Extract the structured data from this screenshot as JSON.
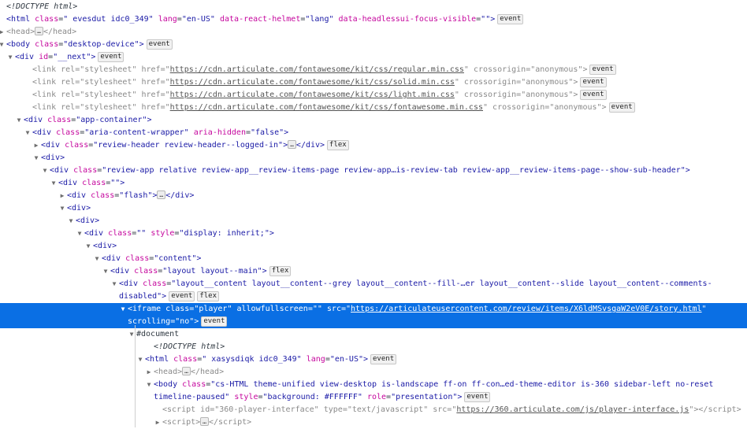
{
  "colors": {
    "selection": "#0a6fe4",
    "tag": "#1a1aa6",
    "attribute": "#c5069d"
  },
  "rows": [
    {
      "level": 0,
      "noarrowpad": true,
      "tokens": [
        {
          "k": "comment",
          "t": "<!DOCTYPE html>"
        }
      ]
    },
    {
      "level": 0,
      "noarrowpad": true,
      "tokens": [
        {
          "k": "tag",
          "t": "<html "
        },
        {
          "k": "attr",
          "t": "class"
        },
        {
          "k": "plain",
          "t": "="
        },
        {
          "k": "val",
          "t": "\" evesdut idc0_349\" "
        },
        {
          "k": "attr",
          "t": "lang"
        },
        {
          "k": "plain",
          "t": "="
        },
        {
          "k": "val",
          "t": "\"en-US\" "
        },
        {
          "k": "attr",
          "t": "data-react-helmet"
        },
        {
          "k": "plain",
          "t": "="
        },
        {
          "k": "val",
          "t": "\"lang\" "
        },
        {
          "k": "attr",
          "t": "data-headlessui-focus-visible"
        },
        {
          "k": "plain",
          "t": "="
        },
        {
          "k": "val",
          "t": "\"\">"
        },
        {
          "k": "badge",
          "t": "event"
        }
      ]
    },
    {
      "level": -1,
      "arrow": "collapsed",
      "dim": true,
      "tokens": [
        {
          "k": "tag",
          "t": "<head>"
        },
        {
          "k": "ell",
          "t": "…"
        },
        {
          "k": "tag",
          "t": "</head>"
        }
      ]
    },
    {
      "level": -1,
      "arrow": "expanded",
      "tokens": [
        {
          "k": "tag",
          "t": "<body "
        },
        {
          "k": "attr",
          "t": "class"
        },
        {
          "k": "plain",
          "t": "="
        },
        {
          "k": "val",
          "t": "\"desktop-device\">"
        },
        {
          "k": "badge",
          "t": "event"
        }
      ]
    },
    {
      "level": 0,
      "arrow": "expanded",
      "tokens": [
        {
          "k": "tag",
          "t": "<div "
        },
        {
          "k": "attr",
          "t": "id"
        },
        {
          "k": "plain",
          "t": "="
        },
        {
          "k": "val",
          "t": "\"__next\">"
        },
        {
          "k": "badge",
          "t": "event"
        }
      ]
    },
    {
      "level": 2,
      "dim": true,
      "tokens": [
        {
          "k": "tag",
          "t": "<link "
        },
        {
          "k": "attr",
          "t": "rel"
        },
        {
          "k": "plain",
          "t": "="
        },
        {
          "k": "val",
          "t": "\"stylesheet\" "
        },
        {
          "k": "attr",
          "t": "href"
        },
        {
          "k": "plain",
          "t": "=\""
        },
        {
          "k": "link",
          "t": "https://cdn.articulate.com/fontawesome/kit/css/regular.min.css"
        },
        {
          "k": "val",
          "t": "\" "
        },
        {
          "k": "attr",
          "t": "crossorigin"
        },
        {
          "k": "plain",
          "t": "="
        },
        {
          "k": "val",
          "t": "\"anonymous\">"
        },
        {
          "k": "badge",
          "t": "event"
        }
      ]
    },
    {
      "level": 2,
      "dim": true,
      "tokens": [
        {
          "k": "tag",
          "t": "<link "
        },
        {
          "k": "attr",
          "t": "rel"
        },
        {
          "k": "plain",
          "t": "="
        },
        {
          "k": "val",
          "t": "\"stylesheet\" "
        },
        {
          "k": "attr",
          "t": "href"
        },
        {
          "k": "plain",
          "t": "=\""
        },
        {
          "k": "link",
          "t": "https://cdn.articulate.com/fontawesome/kit/css/solid.min.css"
        },
        {
          "k": "val",
          "t": "\" "
        },
        {
          "k": "attr",
          "t": "crossorigin"
        },
        {
          "k": "plain",
          "t": "="
        },
        {
          "k": "val",
          "t": "\"anonymous\">"
        },
        {
          "k": "badge",
          "t": "event"
        }
      ]
    },
    {
      "level": 2,
      "dim": true,
      "tokens": [
        {
          "k": "tag",
          "t": "<link "
        },
        {
          "k": "attr",
          "t": "rel"
        },
        {
          "k": "plain",
          "t": "="
        },
        {
          "k": "val",
          "t": "\"stylesheet\" "
        },
        {
          "k": "attr",
          "t": "href"
        },
        {
          "k": "plain",
          "t": "=\""
        },
        {
          "k": "link",
          "t": "https://cdn.articulate.com/fontawesome/kit/css/light.min.css"
        },
        {
          "k": "val",
          "t": "\" "
        },
        {
          "k": "attr",
          "t": "crossorigin"
        },
        {
          "k": "plain",
          "t": "="
        },
        {
          "k": "val",
          "t": "\"anonymous\">"
        },
        {
          "k": "badge",
          "t": "event"
        }
      ]
    },
    {
      "level": 2,
      "dim": true,
      "tokens": [
        {
          "k": "tag",
          "t": "<link "
        },
        {
          "k": "attr",
          "t": "rel"
        },
        {
          "k": "plain",
          "t": "="
        },
        {
          "k": "val",
          "t": "\"stylesheet\" "
        },
        {
          "k": "attr",
          "t": "href"
        },
        {
          "k": "plain",
          "t": "=\""
        },
        {
          "k": "link",
          "t": "https://cdn.articulate.com/fontawesome/kit/css/fontawesome.min.css"
        },
        {
          "k": "val",
          "t": "\" "
        },
        {
          "k": "attr",
          "t": "crossorigin"
        },
        {
          "k": "plain",
          "t": "="
        },
        {
          "k": "val",
          "t": "\"anonymous\">"
        },
        {
          "k": "badge",
          "t": "event"
        }
      ]
    },
    {
      "level": 1,
      "arrow": "expanded",
      "tokens": [
        {
          "k": "tag",
          "t": "<div "
        },
        {
          "k": "attr",
          "t": "class"
        },
        {
          "k": "plain",
          "t": "="
        },
        {
          "k": "val",
          "t": "\"app-container\">"
        }
      ]
    },
    {
      "level": 2,
      "arrow": "expanded",
      "tokens": [
        {
          "k": "tag",
          "t": "<div "
        },
        {
          "k": "attr",
          "t": "class"
        },
        {
          "k": "plain",
          "t": "="
        },
        {
          "k": "val",
          "t": "\"aria-content-wrapper\" "
        },
        {
          "k": "attr",
          "t": "aria-hidden"
        },
        {
          "k": "plain",
          "t": "="
        },
        {
          "k": "val",
          "t": "\"false\">"
        }
      ]
    },
    {
      "level": 3,
      "arrow": "collapsed",
      "tokens": [
        {
          "k": "tag",
          "t": "<div "
        },
        {
          "k": "attr",
          "t": "class"
        },
        {
          "k": "plain",
          "t": "="
        },
        {
          "k": "val",
          "t": "\"review-header review-header--logged-in\">"
        },
        {
          "k": "ell",
          "t": "…"
        },
        {
          "k": "tag",
          "t": "</div>"
        },
        {
          "k": "badge",
          "t": "flex"
        }
      ]
    },
    {
      "level": 3,
      "arrow": "expanded",
      "tokens": [
        {
          "k": "tag",
          "t": "<div>"
        }
      ]
    },
    {
      "level": 4,
      "arrow": "expanded",
      "tokens": [
        {
          "k": "tag",
          "t": "<div "
        },
        {
          "k": "attr",
          "t": "class"
        },
        {
          "k": "plain",
          "t": "="
        },
        {
          "k": "val",
          "t": "\"review-app relative review-app__review-items-page review-app…is-review-tab review-app__review-items-page--show-sub-header\">"
        }
      ]
    },
    {
      "level": 5,
      "arrow": "expanded",
      "tokens": [
        {
          "k": "tag",
          "t": "<div "
        },
        {
          "k": "attr",
          "t": "class"
        },
        {
          "k": "plain",
          "t": "="
        },
        {
          "k": "val",
          "t": "\"\">"
        }
      ]
    },
    {
      "level": 6,
      "arrow": "collapsed",
      "tokens": [
        {
          "k": "tag",
          "t": "<div "
        },
        {
          "k": "attr",
          "t": "class"
        },
        {
          "k": "plain",
          "t": "="
        },
        {
          "k": "val",
          "t": "\"flash\">"
        },
        {
          "k": "ell",
          "t": "…"
        },
        {
          "k": "tag",
          "t": "</div>"
        }
      ]
    },
    {
      "level": 6,
      "arrow": "expanded",
      "tokens": [
        {
          "k": "tag",
          "t": "<div>"
        }
      ]
    },
    {
      "level": 7,
      "arrow": "expanded",
      "tokens": [
        {
          "k": "tag",
          "t": "<div>"
        }
      ]
    },
    {
      "level": 8,
      "arrow": "expanded",
      "tokens": [
        {
          "k": "tag",
          "t": "<div "
        },
        {
          "k": "attr",
          "t": "class"
        },
        {
          "k": "plain",
          "t": "="
        },
        {
          "k": "val",
          "t": "\"\" "
        },
        {
          "k": "attr",
          "t": "style"
        },
        {
          "k": "plain",
          "t": "="
        },
        {
          "k": "val",
          "t": "\"display: inherit;\">"
        }
      ]
    },
    {
      "level": 9,
      "arrow": "expanded",
      "tokens": [
        {
          "k": "tag",
          "t": "<div>"
        }
      ]
    },
    {
      "level": 10,
      "arrow": "expanded",
      "tokens": [
        {
          "k": "tag",
          "t": "<div "
        },
        {
          "k": "attr",
          "t": "class"
        },
        {
          "k": "plain",
          "t": "="
        },
        {
          "k": "val",
          "t": "\"content\">"
        }
      ]
    },
    {
      "level": 11,
      "arrow": "expanded",
      "tokens": [
        {
          "k": "tag",
          "t": "<div "
        },
        {
          "k": "attr",
          "t": "class"
        },
        {
          "k": "plain",
          "t": "="
        },
        {
          "k": "val",
          "t": "\"layout layout--main\">"
        },
        {
          "k": "badge",
          "t": "flex"
        }
      ]
    },
    {
      "level": 12,
      "arrow": "expanded",
      "tokens": [
        {
          "k": "tag",
          "t": "<div "
        },
        {
          "k": "attr",
          "t": "class"
        },
        {
          "k": "plain",
          "t": "="
        },
        {
          "k": "val",
          "t": "\"layout__content layout__content--grey layout__content--fill-…er layout__content--slide layout__content--comments-"
        },
        {
          "k": "br"
        },
        {
          "k": "val",
          "t": "disabled\">"
        },
        {
          "k": "badge",
          "t": "event"
        },
        {
          "k": "badge",
          "t": "flex"
        }
      ]
    },
    {
      "level": 13,
      "arrow": "expanded",
      "selected": true,
      "tokens": [
        {
          "k": "tag",
          "t": "<iframe "
        },
        {
          "k": "attr",
          "t": "class"
        },
        {
          "k": "plain",
          "t": "="
        },
        {
          "k": "val",
          "t": "\"player\" "
        },
        {
          "k": "attr",
          "t": "allowfullscreen"
        },
        {
          "k": "plain",
          "t": "="
        },
        {
          "k": "val",
          "t": "\"\" "
        },
        {
          "k": "attr",
          "t": "src"
        },
        {
          "k": "plain",
          "t": "=\""
        },
        {
          "k": "link",
          "t": "https://articulateusercontent.com/review/items/X6ldMSvsgaW2eV0E/story.html"
        },
        {
          "k": "val",
          "t": "\""
        },
        {
          "k": "br"
        },
        {
          "k": "attr",
          "t": "scrolling"
        },
        {
          "k": "plain",
          "t": "="
        },
        {
          "k": "val",
          "t": "\"no\">"
        },
        {
          "k": "badge",
          "t": "event"
        }
      ]
    },
    {
      "level": 14,
      "arrow": "expanded",
      "tokens": [
        {
          "k": "plain",
          "t": "#document"
        }
      ]
    },
    {
      "level": 16,
      "tokens": [
        {
          "k": "comment",
          "t": "<!DOCTYPE html>"
        }
      ]
    },
    {
      "level": 15,
      "arrow": "expanded",
      "tokens": [
        {
          "k": "tag",
          "t": "<html "
        },
        {
          "k": "attr",
          "t": "class"
        },
        {
          "k": "plain",
          "t": "="
        },
        {
          "k": "val",
          "t": "\" xasysdiqk idc0_349\" "
        },
        {
          "k": "attr",
          "t": "lang"
        },
        {
          "k": "plain",
          "t": "="
        },
        {
          "k": "val",
          "t": "\"en-US\">"
        },
        {
          "k": "badge",
          "t": "event"
        }
      ]
    },
    {
      "level": 16,
      "arrow": "collapsed",
      "dim": true,
      "tokens": [
        {
          "k": "tag",
          "t": "<head>"
        },
        {
          "k": "ell",
          "t": "…"
        },
        {
          "k": "tag",
          "t": "</head>"
        }
      ]
    },
    {
      "level": 16,
      "arrow": "expanded",
      "tokens": [
        {
          "k": "tag",
          "t": "<body "
        },
        {
          "k": "attr",
          "t": "class"
        },
        {
          "k": "plain",
          "t": "="
        },
        {
          "k": "val",
          "t": "\"cs-HTML theme-unified view-desktop is-landscape ff-on ff-con…ed-theme-editor is-360 sidebar-left no-reset"
        },
        {
          "k": "br"
        },
        {
          "k": "val",
          "t": "timeline-paused\" "
        },
        {
          "k": "attr",
          "t": "style"
        },
        {
          "k": "plain",
          "t": "="
        },
        {
          "k": "val",
          "t": "\"background: #FFFFFF\" "
        },
        {
          "k": "attr",
          "t": "role"
        },
        {
          "k": "plain",
          "t": "="
        },
        {
          "k": "val",
          "t": "\"presentation\">"
        },
        {
          "k": "badge",
          "t": "event"
        }
      ]
    },
    {
      "level": 17,
      "dim": true,
      "tokens": [
        {
          "k": "tag",
          "t": "<script "
        },
        {
          "k": "attr",
          "t": "id"
        },
        {
          "k": "plain",
          "t": "="
        },
        {
          "k": "val",
          "t": "\"360-player-interface\" "
        },
        {
          "k": "attr",
          "t": "type"
        },
        {
          "k": "plain",
          "t": "="
        },
        {
          "k": "val",
          "t": "\"text/javascript\" "
        },
        {
          "k": "attr",
          "t": "src"
        },
        {
          "k": "plain",
          "t": "=\""
        },
        {
          "k": "link",
          "t": "https://360.articulate.com/js/player-interface.js"
        },
        {
          "k": "val",
          "t": "\">"
        },
        {
          "k": "tag",
          "t": "</script>"
        }
      ]
    },
    {
      "level": 17,
      "arrow": "collapsed",
      "dim": true,
      "tokens": [
        {
          "k": "tag",
          "t": "<script>"
        },
        {
          "k": "ell",
          "t": "…"
        },
        {
          "k": "tag",
          "t": "</script>"
        }
      ]
    }
  ]
}
